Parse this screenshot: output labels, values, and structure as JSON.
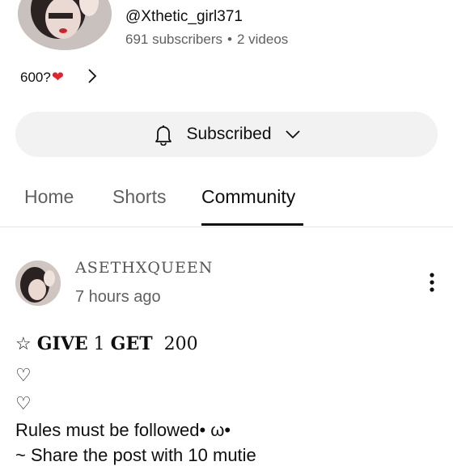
{
  "channel": {
    "handle": "@Xthetic_girl371",
    "subscribers": "691 subscribers",
    "separator": "•",
    "videos": "2 videos",
    "description": "600?",
    "description_emoji": "❤",
    "expand_icon": "chevron-right-icon"
  },
  "subscribe": {
    "label": "Subscribed",
    "bell_icon": "bell-icon",
    "dropdown_icon": "chevron-down-icon"
  },
  "tabs": [
    {
      "label": "Home",
      "active": false
    },
    {
      "label": "Shorts",
      "active": false
    },
    {
      "label": "Community",
      "active": true
    }
  ],
  "post": {
    "author": "ASETHXQUEEN",
    "time": "7 hours ago",
    "menu_icon": "more-vert-icon",
    "lines": {
      "line1_star": "☆",
      "line1_give": "GIVE",
      "line1_n1": "1",
      "line1_get": "GET",
      "line1_n2": "200",
      "line2": "♡",
      "line3": "♡",
      "line4": "Rules must be followed• ω•",
      "line5": "~ Share the post with 10 mutie"
    }
  },
  "colors": {
    "text": "#0f0f0f",
    "secondary": "#606060",
    "button_bg": "#f2f2f2",
    "heart": "#e0242b"
  }
}
